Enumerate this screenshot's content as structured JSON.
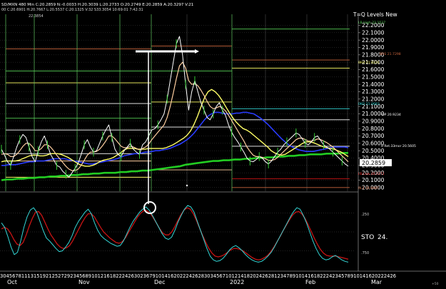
{
  "header": {
    "line1": "SD/MXN 480 Min C:20.2859 N:-0.0033 H:20.3039 L:20.2733 O:20.2749 E:20.2859 A:20.3297 V:21",
    "line2": "00 C:20.6901 H:20.7667 L:20.5537 C:20.1325 V:32 S33.3054 10:69:01 7:42:31"
  },
  "panel_title": "T=Q Levels New",
  "top_value_label": "22.3854",
  "colors": {
    "background": "#000000",
    "grid": "#5a5a5a",
    "price": "#ffffff",
    "ema_fast": "#ffcfa0",
    "ema_mid": "#ffff66",
    "ema_slow": "#2a3cff",
    "ema_long": "#22cc22",
    "stoch_k": "#33d6d6",
    "stoch_d": "#c81414",
    "current_price_box": "#ffffff"
  },
  "level_labels": [
    {
      "text": "LB High 22.1527",
      "color": "#55cc55"
    },
    {
      "text": "BRS 21.7298",
      "color": "#c8643c"
    },
    {
      "text": "0H4 21.6231",
      "color": "#ffff66"
    },
    {
      "text": "0KO 21.0683",
      "color": "#33d6d6"
    },
    {
      "text": "OP 20.9234",
      "color": "#ffffff"
    },
    {
      "text": "0 Ret.33mor 20.5605",
      "color": "#ffffff"
    },
    {
      "text": "LB Low 20.1171",
      "color": "#c81414"
    },
    {
      "text": "0L3 19.9987",
      "color": "#c8643c"
    }
  ],
  "price_axis_ticks": [
    "22.2000",
    "22.1000",
    "22.0000",
    "21.9000",
    "21.8000",
    "21.7000",
    "21.6000",
    "21.5000",
    "21.4000",
    "21.3000",
    "21.2000",
    "21.1000",
    "21.0000",
    "20.9000",
    "20.8000",
    "20.7000",
    "20.6000",
    "20.5000",
    "20.4000",
    "20.3000",
    "20.2000",
    "20.1000",
    "20.0000"
  ],
  "current_price": "20.2859",
  "stoch": {
    "label": "STO",
    "value": "24.",
    "ticks": [
      ".250",
      ".750"
    ]
  },
  "date_axis": {
    "day_digits": "3045678111315192125272923456891012161822242630236791014162022242628303456710121418202426281234789101416182224234578910141620222426",
    "month_labels": [
      "Oct",
      "Nov",
      "Dec",
      "2022",
      "Feb",
      "Mar"
    ],
    "corner_label": "+50"
  },
  "chart_data": {
    "type": "line",
    "title": "SD/MXN 480 Min",
    "xlabel": "",
    "ylabel": "",
    "x_months": [
      "Oct",
      "Nov",
      "Dec",
      "2022",
      "Feb",
      "Mar"
    ],
    "ylim": [
      19.95,
      22.35
    ],
    "grid": true,
    "series": [
      {
        "name": "price",
        "values": [
          20.52,
          20.44,
          20.35,
          20.3,
          20.42,
          20.55,
          20.65,
          20.72,
          20.68,
          20.55,
          20.42,
          20.35,
          20.5,
          20.62,
          20.7,
          20.58,
          20.45,
          20.38,
          20.3,
          20.28,
          20.22,
          20.18,
          20.14,
          20.2,
          20.26,
          20.33,
          20.45,
          20.58,
          20.65,
          20.55,
          20.48,
          20.5,
          20.6,
          20.7,
          20.78,
          20.85,
          20.68,
          20.52,
          20.45,
          20.42,
          20.5,
          20.55,
          20.6,
          20.52,
          20.48,
          20.45,
          20.58,
          20.62,
          20.7,
          20.78,
          20.8,
          20.85,
          20.92,
          21.0,
          21.2,
          21.45,
          21.7,
          21.95,
          22.05,
          21.8,
          21.4,
          21.05,
          21.3,
          21.45,
          21.3,
          21.15,
          21.05,
          20.95,
          20.92,
          21.0,
          21.1,
          21.15,
          21.05,
          20.98,
          20.85,
          20.75,
          20.68,
          20.62,
          20.55,
          20.48,
          20.4,
          20.36,
          20.35,
          20.38,
          20.42,
          20.4,
          20.35,
          20.32,
          20.36,
          20.42,
          20.48,
          20.52,
          20.58,
          20.62,
          20.66,
          20.7,
          20.74,
          20.72,
          20.66,
          20.6,
          20.58,
          20.62,
          20.68,
          20.7,
          20.64,
          20.58,
          20.55,
          20.52,
          20.48,
          20.44,
          20.4,
          20.36,
          20.32,
          20.29
        ]
      },
      {
        "name": "",
        "values": [
          20.45,
          20.46,
          20.45,
          20.42,
          20.42,
          20.45,
          20.5,
          20.56,
          20.6,
          20.6,
          20.56,
          20.5,
          20.5,
          20.53,
          20.58,
          20.58,
          20.55,
          20.5,
          20.44,
          20.39,
          20.34,
          20.29,
          20.25,
          20.23,
          20.23,
          20.25,
          20.3,
          20.37,
          20.44,
          20.48,
          20.48,
          20.49,
          20.52,
          20.57,
          20.63,
          20.7,
          20.7,
          20.66,
          20.61,
          20.56,
          20.54,
          20.54,
          20.56,
          20.55,
          20.53,
          20.51,
          20.53,
          20.55,
          20.59,
          20.65,
          20.7,
          20.75,
          20.8,
          20.85,
          20.95,
          21.1,
          21.28,
          21.48,
          21.65,
          21.7,
          21.62,
          21.45,
          21.4,
          21.41,
          21.38,
          21.32,
          21.25,
          21.17,
          21.1,
          21.07,
          21.08,
          21.1,
          21.08,
          21.04,
          20.98,
          20.91,
          20.84,
          20.77,
          20.7,
          20.63,
          20.55,
          20.49,
          20.44,
          20.42,
          20.42,
          20.41,
          20.39,
          20.37,
          20.37,
          20.38,
          20.41,
          20.45,
          20.49,
          20.53,
          20.57,
          20.61,
          20.65,
          20.67,
          20.67,
          20.65,
          20.63,
          20.63,
          20.64,
          20.66,
          20.65,
          20.63,
          20.61,
          20.58,
          20.55,
          20.51,
          20.47,
          20.43,
          20.39,
          20.35
        ]
      },
      {
        "name": "",
        "values": [
          20.35,
          20.36,
          20.36,
          20.36,
          20.36,
          20.37,
          20.39,
          20.41,
          20.43,
          20.44,
          20.44,
          20.43,
          20.43,
          20.44,
          20.46,
          20.46,
          20.46,
          20.45,
          20.43,
          20.41,
          20.38,
          20.35,
          20.32,
          20.3,
          20.29,
          20.29,
          20.3,
          20.32,
          20.35,
          20.37,
          20.38,
          20.39,
          20.41,
          20.44,
          20.47,
          20.51,
          20.53,
          20.53,
          20.53,
          20.52,
          20.52,
          20.52,
          20.53,
          20.53,
          20.53,
          20.53,
          20.53,
          20.54,
          20.56,
          20.58,
          20.61,
          20.64,
          20.67,
          20.71,
          20.77,
          20.86,
          20.97,
          21.1,
          21.22,
          21.3,
          21.33,
          21.3,
          21.25,
          21.18,
          21.1,
          21.02,
          20.95,
          20.89,
          20.84,
          20.8,
          20.78,
          20.75,
          20.71,
          20.67,
          20.63,
          20.59,
          20.55,
          20.5,
          20.47,
          20.45,
          20.44,
          20.45,
          20.48,
          20.51,
          20.54,
          20.57,
          20.6,
          20.62,
          20.62,
          20.61,
          20.59,
          20.57,
          20.55,
          20.54,
          20.53,
          20.52,
          20.5,
          20.48,
          20.45,
          20.42
        ]
      },
      {
        "name": "",
        "values": [
          20.3,
          20.3,
          20.31,
          20.31,
          20.31,
          20.32,
          20.33,
          20.34,
          20.35,
          20.35,
          20.36,
          20.36,
          20.36,
          20.37,
          20.38,
          20.39,
          20.39,
          20.39,
          20.39,
          20.38,
          20.37,
          20.36,
          20.35,
          20.34,
          20.33,
          20.32,
          20.32,
          20.33,
          20.34,
          20.35,
          20.36,
          20.37,
          20.38,
          20.39,
          20.41,
          20.43,
          20.44,
          20.45,
          20.46,
          20.46,
          20.47,
          20.48,
          20.48,
          20.49,
          20.5,
          20.5,
          20.51,
          20.52,
          20.53,
          20.55,
          20.57,
          20.59,
          20.62,
          20.65,
          20.69,
          20.74,
          20.8,
          20.86,
          20.92,
          20.97,
          21.0,
          21.02,
          21.02,
          21.01,
          21.0,
          21.0,
          21.0,
          21.01,
          21.01,
          21.02,
          21.02,
          21.01,
          21.0,
          20.97,
          20.94,
          20.9,
          20.86,
          20.81,
          20.76,
          20.71,
          20.66,
          20.62,
          20.58,
          20.55,
          20.53,
          20.51,
          20.5,
          20.49,
          20.49,
          20.49,
          20.5,
          20.51,
          20.52,
          20.53,
          20.54,
          20.55,
          20.55,
          20.55,
          20.55,
          20.54
        ]
      },
      {
        "name": "",
        "values": [
          20.1,
          20.11,
          20.11,
          20.12,
          20.12,
          20.13,
          20.13,
          20.14,
          20.14,
          20.15,
          20.15,
          20.16,
          20.16,
          20.17,
          20.17,
          20.18,
          20.18,
          20.19,
          20.19,
          20.2,
          20.2,
          20.2,
          20.21,
          20.21,
          20.22,
          20.22,
          20.23,
          20.23,
          20.24,
          20.25,
          20.26,
          20.27,
          20.28,
          20.29,
          20.31,
          20.32,
          20.33,
          20.34,
          20.35,
          20.36,
          20.36,
          20.37,
          20.37,
          20.38,
          20.38,
          20.39,
          20.39,
          20.4,
          20.4,
          20.41,
          20.41,
          20.42,
          20.42,
          20.43,
          20.43,
          20.44,
          20.44,
          20.45,
          20.45,
          20.45,
          20.46,
          20.46,
          20.46,
          20.47,
          20.47
        ]
      }
    ],
    "stochastic": {
      "k": [
        620,
        560,
        440,
        300,
        200,
        230,
        380,
        560,
        700,
        790,
        820,
        760,
        640,
        520,
        420,
        380,
        330,
        280,
        240,
        250,
        300,
        360,
        450,
        560,
        640,
        700,
        760,
        800,
        740,
        620,
        520,
        450,
        410,
        380,
        350,
        330,
        310,
        320,
        380,
        470,
        560,
        640,
        700,
        760,
        800,
        830,
        790,
        720,
        640,
        560,
        480,
        420,
        400,
        430,
        520,
        630,
        720,
        800,
        850,
        830,
        760,
        640,
        520,
        400,
        280,
        180,
        130,
        110,
        120,
        150,
        200,
        260,
        300,
        320,
        290,
        250,
        200,
        160,
        130,
        110,
        100,
        110,
        140,
        180,
        230,
        300,
        380,
        460,
        540,
        620,
        700,
        770,
        820,
        800,
        720,
        620,
        500,
        380,
        280,
        200,
        150,
        130,
        140,
        170,
        190,
        160,
        130,
        110,
        100
      ],
      "d": [
        540,
        560,
        540,
        480,
        400,
        340,
        320,
        360,
        460,
        580,
        680,
        760,
        770,
        720,
        630,
        540,
        460,
        400,
        340,
        300,
        280,
        290,
        320,
        380,
        460,
        540,
        620,
        690,
        740,
        740,
        700,
        630,
        560,
        500,
        460,
        420,
        390,
        360,
        350,
        370,
        420,
        490,
        560,
        630,
        700,
        750,
        780,
        780,
        750,
        690,
        620,
        550,
        490,
        460,
        460,
        500,
        570,
        650,
        730,
        790,
        820,
        800,
        740,
        650,
        550,
        450,
        360,
        280,
        220,
        180,
        170,
        180,
        200,
        230,
        260,
        280,
        280,
        270,
        250,
        220,
        190,
        160,
        140,
        130,
        140,
        160,
        190,
        240,
        300,
        370,
        440,
        520,
        590,
        660,
        720,
        760,
        770,
        740,
        680,
        600,
        510,
        420,
        340,
        270,
        220,
        190,
        180,
        180,
        180,
        170,
        160,
        150,
        140
      ]
    }
  }
}
